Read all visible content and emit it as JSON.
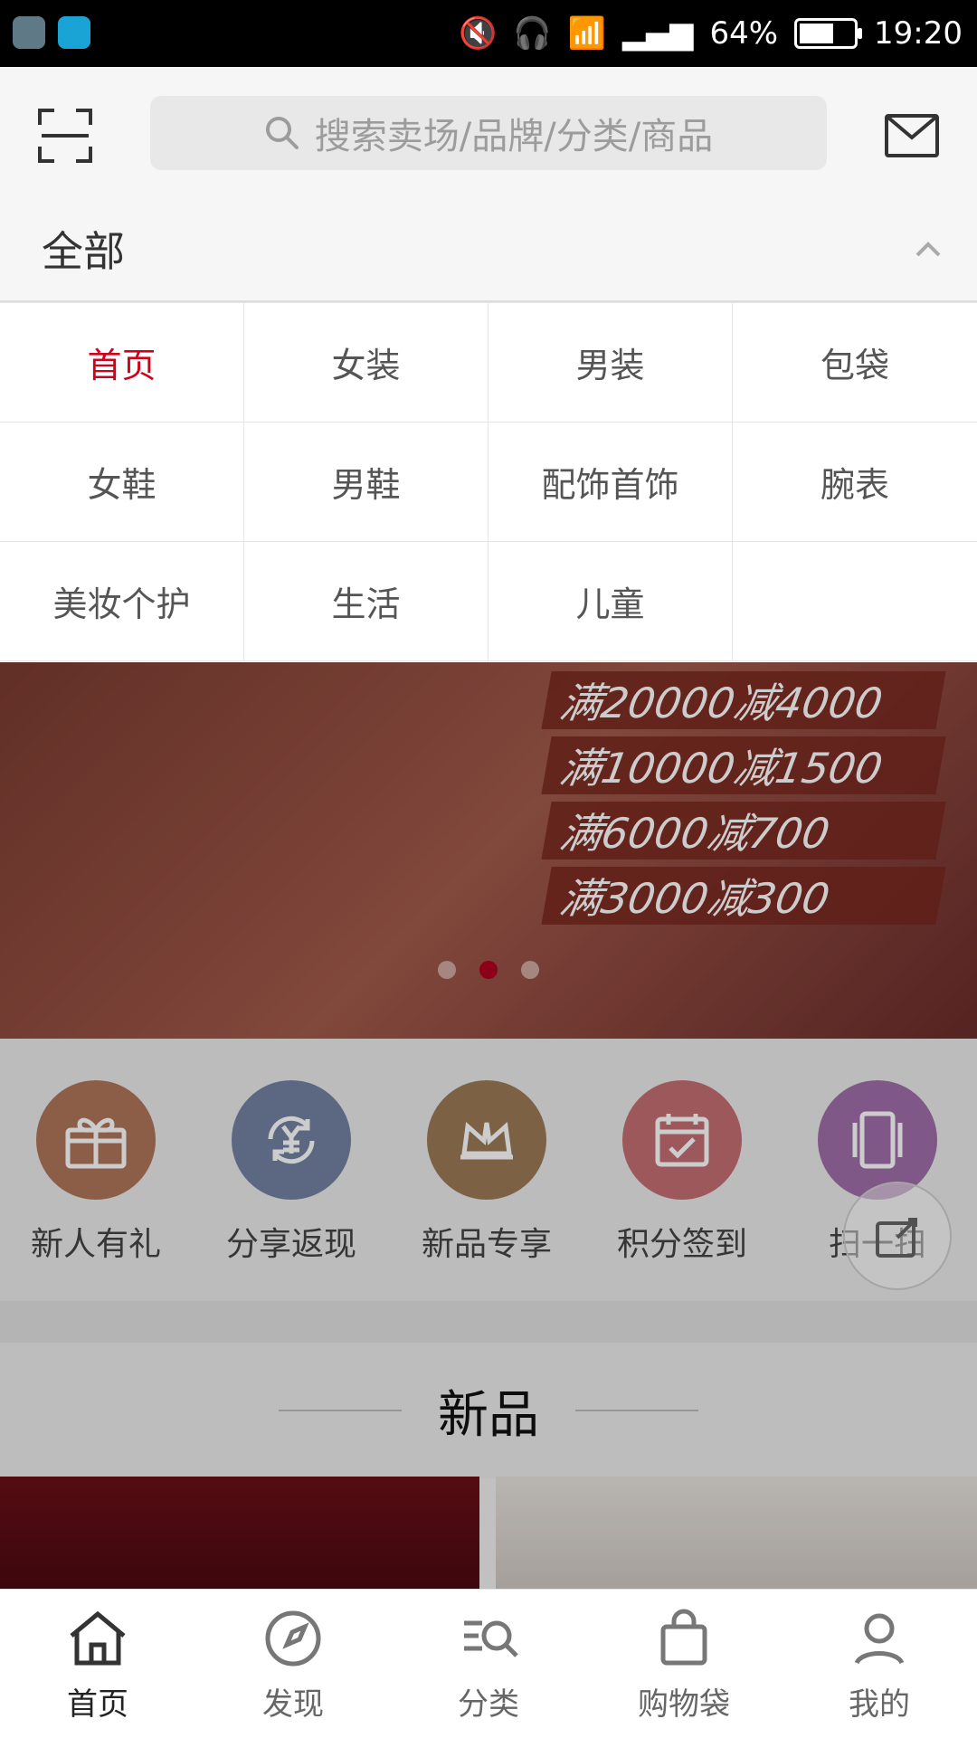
{
  "status": {
    "battery": "64%",
    "time": "19:20",
    "battery_level": 0.64
  },
  "header": {
    "search_placeholder": "搜索卖场/品牌/分类/商品"
  },
  "all_row": {
    "title": "全部"
  },
  "categories": [
    {
      "label": "首页",
      "active": true
    },
    {
      "label": "女装"
    },
    {
      "label": "男装"
    },
    {
      "label": "包袋"
    },
    {
      "label": "女鞋"
    },
    {
      "label": "男鞋"
    },
    {
      "label": "配饰首饰"
    },
    {
      "label": "腕表"
    },
    {
      "label": "美妆个护"
    },
    {
      "label": "生活"
    },
    {
      "label": "儿童"
    },
    {
      "label": ""
    }
  ],
  "banner": {
    "promos": [
      "满20000减4000",
      "满10000减1500",
      "满6000减700",
      "满3000减300"
    ],
    "pager_total": 3,
    "pager_active_index": 1
  },
  "quick_icons": [
    {
      "label": "新人有礼",
      "color": "#b0765a",
      "icon": "gift-icon"
    },
    {
      "label": "分享返现",
      "color": "#7383a3",
      "icon": "yen-refresh-icon"
    },
    {
      "label": "新品专享",
      "color": "#9b7a57",
      "icon": "crown-icon"
    },
    {
      "label": "积分签到",
      "color": "#c36f72",
      "icon": "calendar-check-icon"
    },
    {
      "label": "扫一扫",
      "color": "#a06ea9",
      "icon": "phone-icon"
    }
  ],
  "new_section": {
    "title": "新品"
  },
  "bottom_nav": [
    {
      "label": "首页",
      "icon": "home-icon",
      "active": true
    },
    {
      "label": "发现",
      "icon": "compass-icon"
    },
    {
      "label": "分类",
      "icon": "category-search-icon"
    },
    {
      "label": "购物袋",
      "icon": "bag-icon"
    },
    {
      "label": "我的",
      "icon": "user-icon"
    }
  ]
}
